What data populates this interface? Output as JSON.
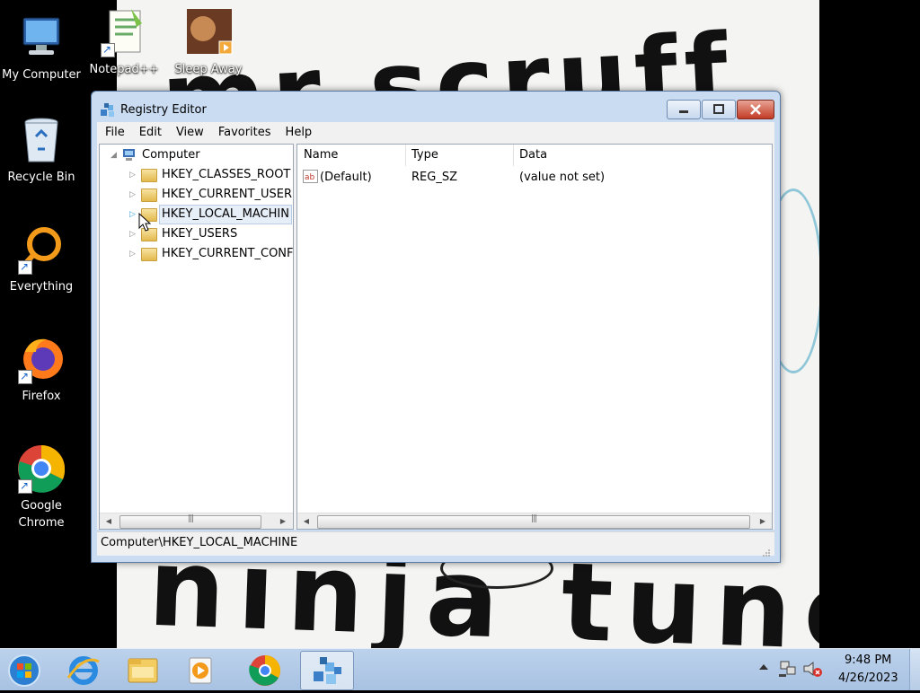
{
  "desktop": {
    "wallpaper_text": {
      "top": "mr scruff",
      "bottom": "ninja tune"
    },
    "icons": [
      {
        "label": "My Computer",
        "icon": "computer-icon"
      },
      {
        "label": "Notepad++",
        "icon": "notepadpp-icon"
      },
      {
        "label": "Sleep Away",
        "icon": "media-file-icon"
      },
      {
        "label": "Recycle Bin",
        "icon": "recycle-bin-icon"
      },
      {
        "label": "Everything",
        "icon": "everything-search-icon"
      },
      {
        "label": "Firefox",
        "icon": "firefox-icon"
      },
      {
        "label": "Google\nChrome",
        "icon": "chrome-icon"
      }
    ]
  },
  "window": {
    "title": "Registry Editor",
    "menu": [
      "File",
      "Edit",
      "View",
      "Favorites",
      "Help"
    ],
    "tree": {
      "root": "Computer",
      "keys": [
        "HKEY_CLASSES_ROOT",
        "HKEY_CURRENT_USER",
        "HKEY_LOCAL_MACHIN",
        "HKEY_USERS",
        "HKEY_CURRENT_CONFI"
      ],
      "selected": "HKEY_LOCAL_MACHINE"
    },
    "list": {
      "columns": [
        "Name",
        "Type",
        "Data"
      ],
      "rows": [
        {
          "name": "(Default)",
          "type": "REG_SZ",
          "data": "(value not set)"
        }
      ]
    },
    "status": "Computer\\HKEY_LOCAL_MACHINE"
  },
  "taskbar": {
    "pinned": [
      "start-orb-icon",
      "internet-explorer-icon",
      "file-explorer-icon",
      "media-player-icon",
      "chrome-icon",
      "regedit-icon"
    ],
    "active": "regedit-icon",
    "clock": {
      "time": "9:48 PM",
      "date": "4/26/2023"
    }
  },
  "colors": {
    "title_bar": "#c9dcf2",
    "close_button": "#c23b25",
    "taskbar": "#b4cbe8"
  }
}
